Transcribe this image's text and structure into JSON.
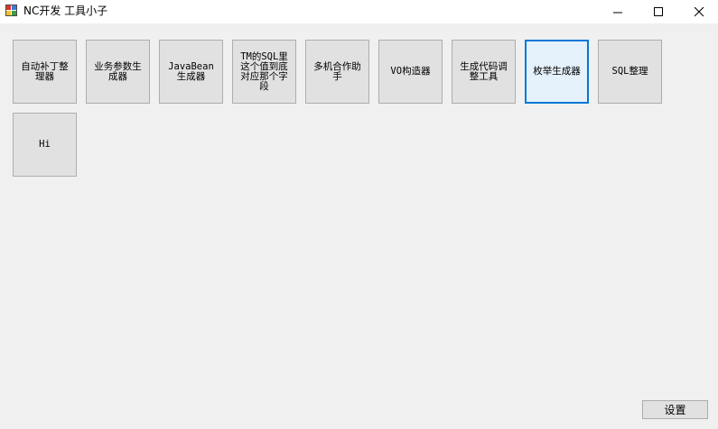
{
  "window": {
    "title": "NC开发 工具小子"
  },
  "tools": [
    {
      "label": "自动补丁整理器"
    },
    {
      "label": "业务参数生成器"
    },
    {
      "label": "JavaBean生成器"
    },
    {
      "label": "TM的SQL里这个值到底对应那个字段"
    },
    {
      "label": "多机合作助手"
    },
    {
      "label": "VO构造器"
    },
    {
      "label": "生成代码调整工具"
    },
    {
      "label": "枚举生成器"
    },
    {
      "label": "SQL整理"
    },
    {
      "label": "Hi"
    }
  ],
  "footer": {
    "settings_label": "设置"
  },
  "colors": {
    "focus_border": "#0078d7",
    "button_face": "#e1e1e1",
    "window_bg": "#f0f0f0"
  }
}
